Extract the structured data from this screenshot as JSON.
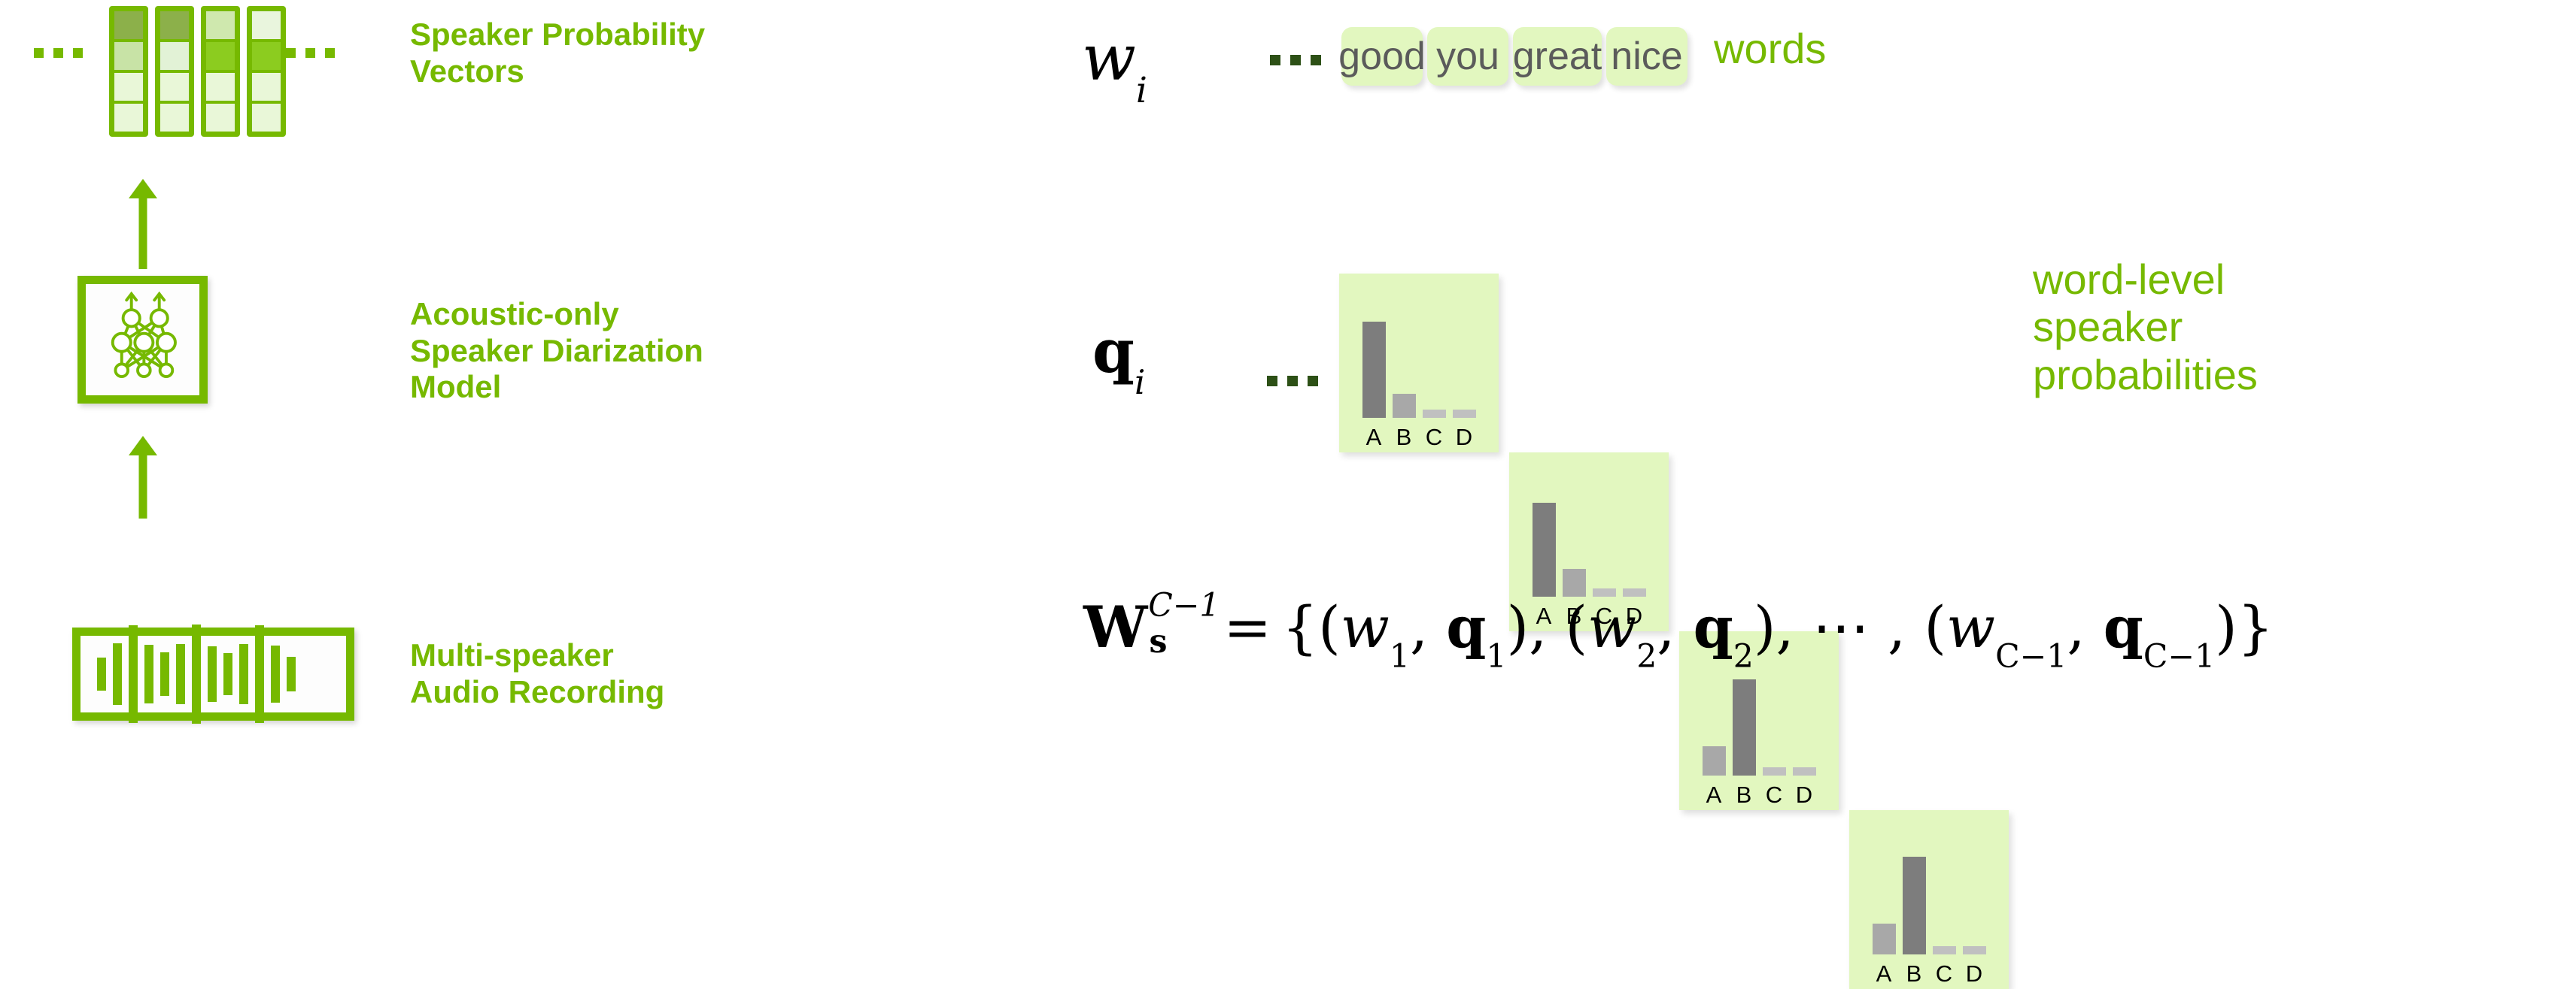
{
  "theme": {
    "green": "#76b900",
    "chip_bg": "#e2f7bf",
    "dark_green_dots": "#2d5016",
    "bar_dark": "#7d7d7d",
    "bar_mid": "#a8a8a8",
    "bar_light": "#c0c0c0"
  },
  "left_panel": {
    "labels": {
      "probability_vectors": "Speaker Probability\nVectors",
      "model": "Acoustic-only\nSpeaker Diarization\nModel",
      "audio": "Multi-speaker\nAudio Recording"
    },
    "icons": {
      "model": "neural-network-icon",
      "audio": "audio-waveform-icon",
      "arrow": "arrow-up-icon",
      "ellipsis": "ellipsis-icon"
    },
    "probability_vectors": {
      "left_ellipsis": "...",
      "right_ellipsis": "...",
      "columns": [
        {
          "cells": [
            "#8cb04a",
            "#c8e3a6",
            "#e9f7d8",
            "#e9f7d8"
          ]
        },
        {
          "cells": [
            "#8cb04a",
            "#e2f2d6",
            "#e9f7d8",
            "#e9f7d8"
          ]
        },
        {
          "cells": [
            "#cfe8ae",
            "#8ccc1f",
            "#e9f7d8",
            "#e9f7d8"
          ]
        },
        {
          "cells": [
            "#e9f5dd",
            "#8ccc1f",
            "#e9f7d8",
            "#e9f7d8"
          ]
        }
      ]
    },
    "neural_network": {
      "output_nodes": 2,
      "hidden_nodes": 3,
      "input_nodes": 3
    },
    "waveform": {
      "bars": [
        44,
        82,
        130,
        78,
        58,
        80,
        132,
        74,
        56,
        80,
        130,
        76,
        46
      ]
    }
  },
  "right_panel": {
    "words_row": {
      "symbol": "w",
      "symbol_subscript": "i",
      "ellipsis": "...",
      "chips": [
        "good",
        "you",
        "great",
        "nice"
      ],
      "label": "words"
    },
    "probs_row": {
      "symbol": "q",
      "symbol_subscript": "i",
      "ellipsis": "...",
      "label": "word-level\nspeaker\nprobabilities"
    },
    "formula": {
      "lhs_symbol": "W",
      "lhs_subscript": "s",
      "lhs_superscript": "C−1",
      "equals": "=",
      "open_brace": "{",
      "close_brace": "}",
      "terms": [
        {
          "w": "w",
          "w_sub": "1",
          "q": "q",
          "q_sub": "1"
        },
        {
          "w": "w",
          "w_sub": "2",
          "q": "q",
          "q_sub": "2"
        },
        {
          "w": "w",
          "w_sub": "C−1",
          "q": "q",
          "q_sub": "C−1"
        }
      ],
      "mid_ellipsis": "⋯",
      "separator": ","
    }
  },
  "chart_data": {
    "type": "bar",
    "title": "word-level speaker probabilities",
    "categories": [
      "A",
      "B",
      "C",
      "D"
    ],
    "ylim": [
      0,
      1
    ],
    "grid": false,
    "legend": "none",
    "xlabel": "",
    "ylabel": "",
    "charts": [
      {
        "word": "good",
        "values": [
          0.72,
          0.18,
          0.06,
          0.06
        ]
      },
      {
        "word": "you",
        "values": [
          0.7,
          0.21,
          0.06,
          0.06
        ]
      },
      {
        "word": "great",
        "values": [
          0.22,
          0.72,
          0.06,
          0.06
        ]
      },
      {
        "word": "nice",
        "values": [
          0.23,
          0.73,
          0.06,
          0.06
        ]
      }
    ]
  }
}
